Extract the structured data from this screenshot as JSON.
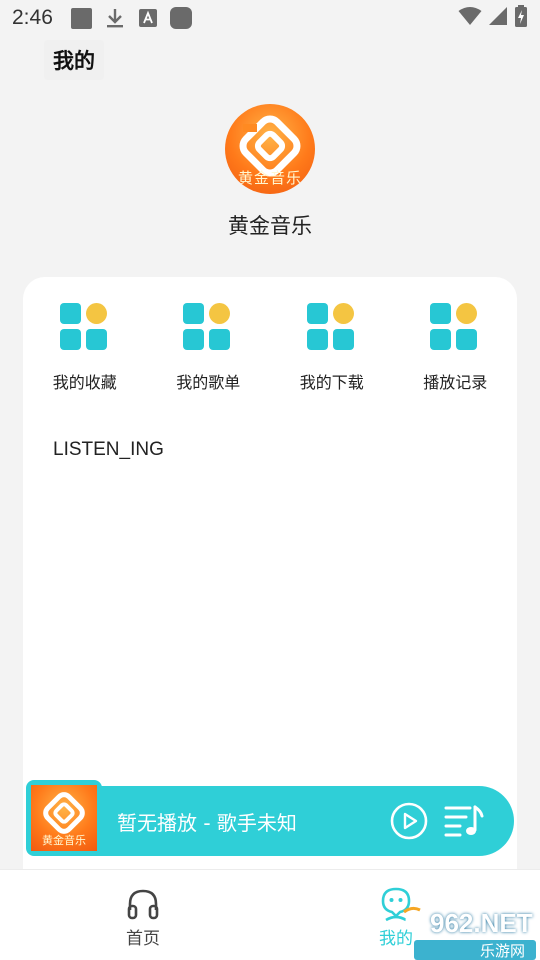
{
  "status_bar": {
    "time": "2:46",
    "left_icons": [
      "app-notification-icon",
      "download-icon",
      "font-a-icon",
      "app-notification-icon"
    ],
    "right_icons": [
      "wifi-icon",
      "cell-signal-icon",
      "battery-charging-icon"
    ]
  },
  "header": {
    "title": "我的"
  },
  "profile": {
    "app_name": "黄金音乐",
    "logo_text": "黄金音乐"
  },
  "shortcuts": [
    {
      "label": "我的收藏",
      "icon": "grid-icon"
    },
    {
      "label": "我的歌单",
      "icon": "grid-icon"
    },
    {
      "label": "我的下载",
      "icon": "grid-icon"
    },
    {
      "label": "播放记录",
      "icon": "grid-icon"
    }
  ],
  "section": {
    "listen_label": "LISTEN_ING"
  },
  "player": {
    "now_playing": "暂无播放 - 歌手未知",
    "cover_text": "黄金音乐",
    "play_icon": "play-circle-icon",
    "playlist_icon": "playlist-icon"
  },
  "tabs": [
    {
      "label": "首页",
      "icon": "headphones-icon",
      "active": false
    },
    {
      "label": "我的",
      "icon": "smiley-user-icon",
      "active": true
    }
  ],
  "watermark": {
    "main": "962.NET",
    "sub": "乐游网"
  },
  "colors": {
    "accent": "#2fcfd7",
    "icon_square": "#27c7d4",
    "icon_dot": "#f4c542",
    "logo_orange": "#ff7a1a",
    "inactive_tab": "#444444",
    "page_bg": "#f3f3f3"
  }
}
